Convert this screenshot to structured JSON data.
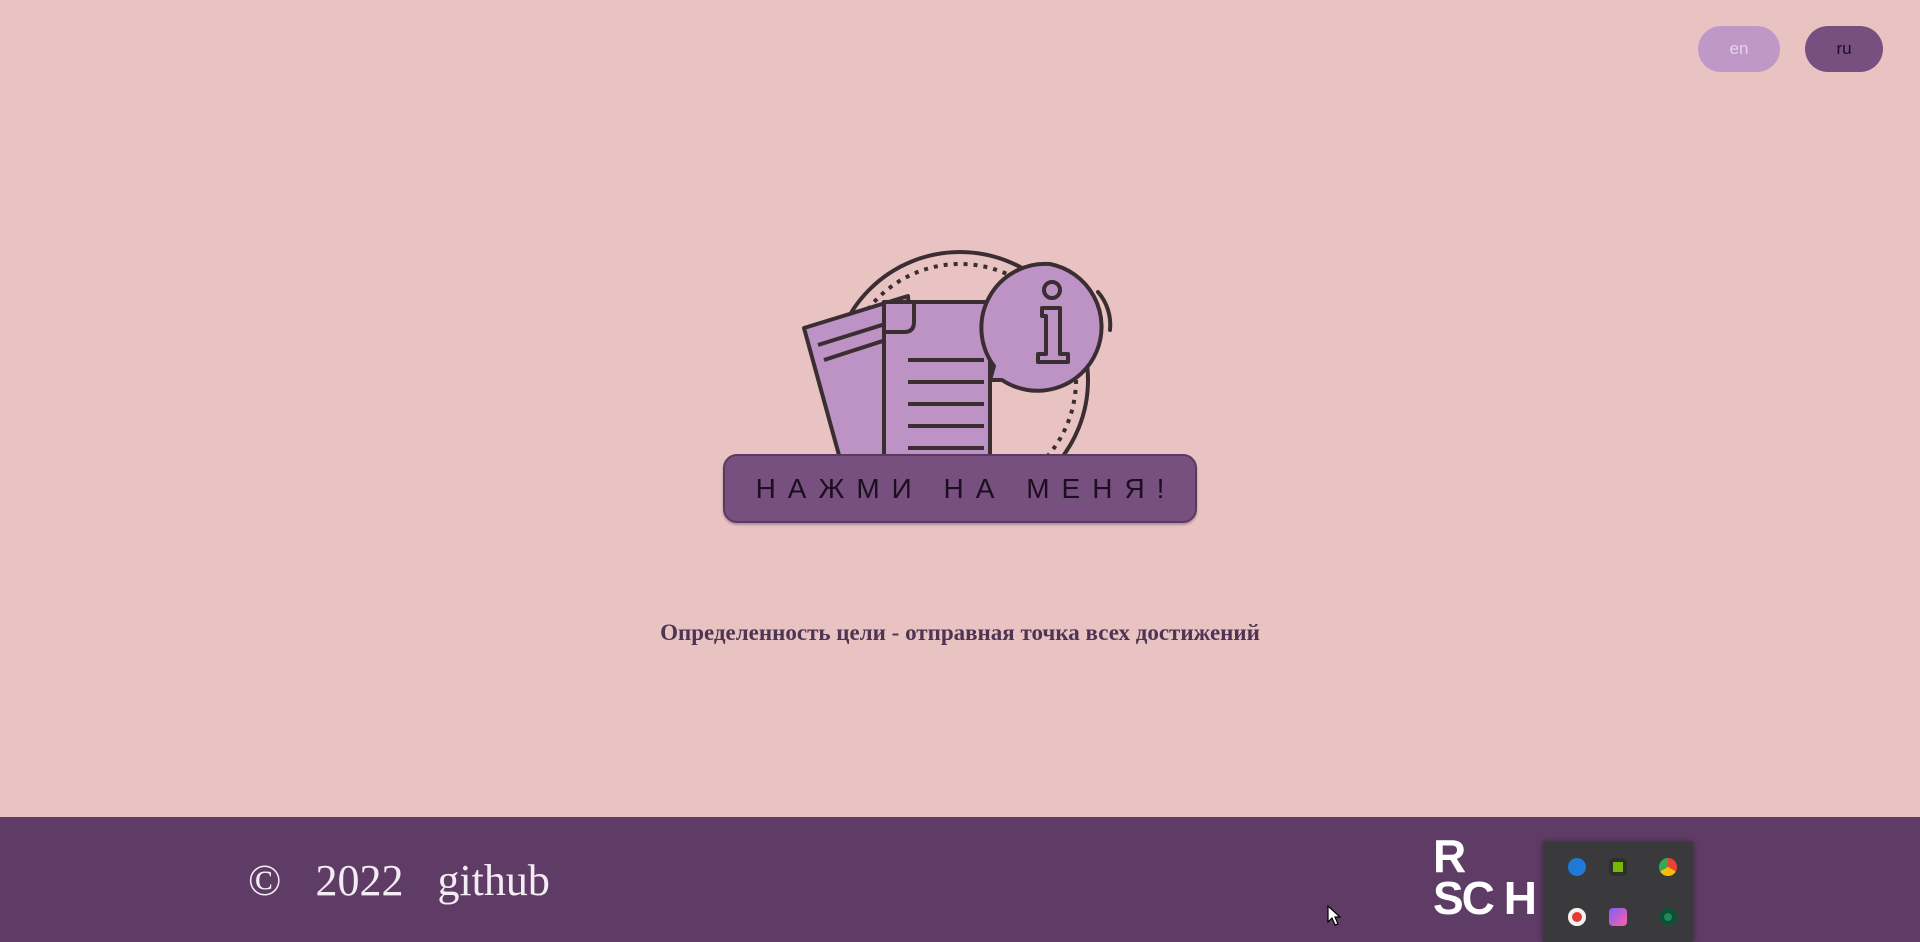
{
  "header": {
    "lang_en": "en",
    "lang_ru": "ru"
  },
  "hero": {
    "illustration_icon": "info-document-icon",
    "button_label": "НАЖМИ НА МЕНЯ!"
  },
  "quote": {
    "text": "Определенность цели - отправная точка всех достижений"
  },
  "footer": {
    "copyright_symbol": "©",
    "year": "2022",
    "github_label": "github",
    "logo_text_line1": "R",
    "logo_text_line2": "SC",
    "logo_text_trailing": "H"
  },
  "system_tray": {
    "icons": [
      "bluetooth-icon",
      "nvidia-icon",
      "chrome-icon",
      "yandex-icon",
      "media-icon",
      "network-icon"
    ]
  },
  "colors": {
    "background": "#e9c3c2",
    "accent": "#78507f",
    "footer": "#5f3c66",
    "lang_en_bg": "#c098c8"
  }
}
